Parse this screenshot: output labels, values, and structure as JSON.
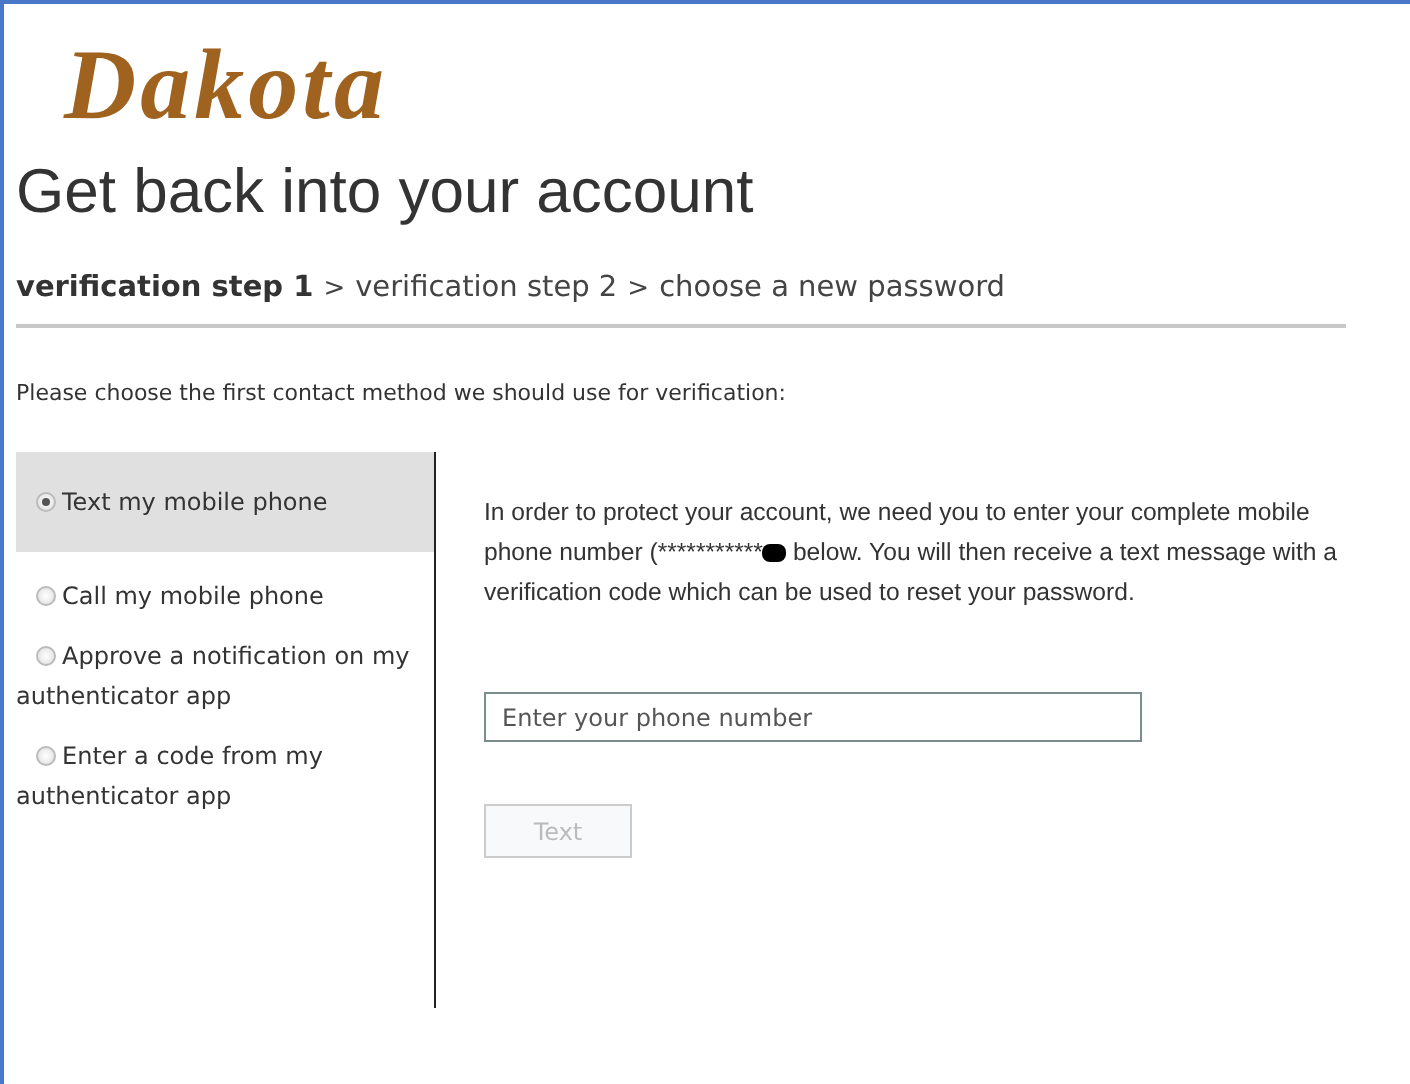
{
  "logo": {
    "text": "Dakota"
  },
  "title": "Get back into your account",
  "steps": [
    {
      "label": "verification step 1",
      "selected": true
    },
    {
      "label": "verification step 2",
      "selected": false
    },
    {
      "label": "choose a new password",
      "selected": false
    }
  ],
  "step_separator": ">",
  "instruction": "Please choose the first contact method we should use for verification:",
  "methods": [
    {
      "label": "Text my mobile phone",
      "selected": true
    },
    {
      "label": "Call my mobile phone",
      "selected": false
    },
    {
      "label": "Approve a notification on my authenticator app",
      "selected": false
    },
    {
      "label": "Enter a code from my authenticator app",
      "selected": false
    }
  ],
  "message": {
    "line_1": "In order to protect your account, we need you to enter your complete mobile",
    "line_2_before_redaction": "phone number (***********",
    "line_2_after_redaction": "below. You will then receive a text message with a",
    "line_3": "verification code which can be used to reset your password."
  },
  "phone_field": {
    "placeholder": "Enter your phone number"
  },
  "submit_button": {
    "label": "Text",
    "disabled": true
  }
}
